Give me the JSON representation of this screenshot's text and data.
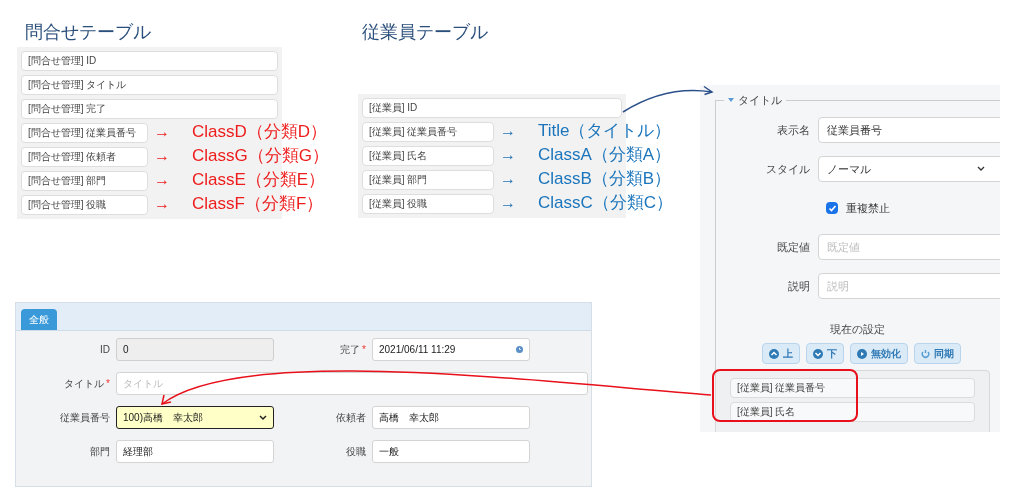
{
  "inquiry_table": {
    "title": "問合せテーブル",
    "fields": [
      {
        "label": "[問合せ管理] ID"
      },
      {
        "label": "[問合せ管理] タイトル"
      },
      {
        "label": "[問合せ管理] 完了"
      },
      {
        "label": "[問合せ管理] 従業員番号",
        "arrow": "→",
        "mapping": "ClassD（分類D）"
      },
      {
        "label": "[問合せ管理] 依頼者",
        "arrow": "→",
        "mapping": "ClassG（分類G）"
      },
      {
        "label": "[問合せ管理] 部門",
        "arrow": "→",
        "mapping": "ClassE（分類E）"
      },
      {
        "label": "[問合せ管理] 役職",
        "arrow": "→",
        "mapping": "ClassF（分類F）"
      }
    ]
  },
  "employee_table": {
    "title": "従業員テーブル",
    "fields": [
      {
        "label": "[従業員] ID"
      },
      {
        "label": "[従業員] 従業員番号",
        "arrow": "→",
        "mapping": "Title（タイトル）"
      },
      {
        "label": "[従業員] 氏名",
        "arrow": "→",
        "mapping": "ClassA（分類A）"
      },
      {
        "label": "[従業員] 部門",
        "arrow": "→",
        "mapping": "ClassB（分類B）"
      },
      {
        "label": "[従業員] 役職",
        "arrow": "→",
        "mapping": "ClassC（分類C）"
      }
    ]
  },
  "settings_panel": {
    "legend": "タイトル",
    "expanded": true,
    "fields": [
      {
        "kind": "input",
        "label": "表示名",
        "value": "従業員番号"
      },
      {
        "kind": "select",
        "label": "スタイル",
        "value": "ノーマル"
      },
      {
        "kind": "checkbox",
        "label": "重複禁止",
        "checked": true
      },
      {
        "kind": "input",
        "label": "既定値",
        "placeholder": "既定値"
      },
      {
        "kind": "input",
        "label": "説明",
        "placeholder": "説明"
      }
    ],
    "current_settings_label": "現在の設定",
    "buttons": [
      {
        "kind": "up",
        "label": "上"
      },
      {
        "kind": "down",
        "label": "下"
      },
      {
        "kind": "disable",
        "label": "無効化"
      },
      {
        "kind": "sync",
        "label": "同期"
      }
    ],
    "current_items": [
      "[従業員] 従業員番号",
      "[従業員] 氏名"
    ]
  },
  "form": {
    "tabs": [
      {
        "label": "全般",
        "selected": true
      }
    ],
    "rows": [
      [
        {
          "kind": "input",
          "label": "ID",
          "value": "0",
          "disabled": true,
          "focused": false
        },
        {
          "kind": "datetime",
          "label": "完了",
          "required_mark": "*",
          "value": "2021/06/11 11:29",
          "disabled": false,
          "focused": false
        }
      ],
      [
        {
          "kind": "input",
          "label": "タイトル",
          "required_mark": "*",
          "placeholder": "タイトル",
          "disabled": false,
          "focused": false
        }
      ],
      [
        {
          "kind": "select",
          "label": "従業員番号",
          "value": "100)高橋　幸太郎",
          "disabled": false,
          "focused": true
        },
        {
          "kind": "input",
          "label": "依頼者",
          "value": "高橋　幸太郎",
          "disabled": false,
          "focused": false
        }
      ],
      [
        {
          "kind": "input",
          "label": "部門",
          "value": "経理部",
          "disabled": false,
          "focused": false
        },
        {
          "kind": "input",
          "label": "役職",
          "value": "一般",
          "disabled": false,
          "focused": false
        }
      ]
    ]
  }
}
